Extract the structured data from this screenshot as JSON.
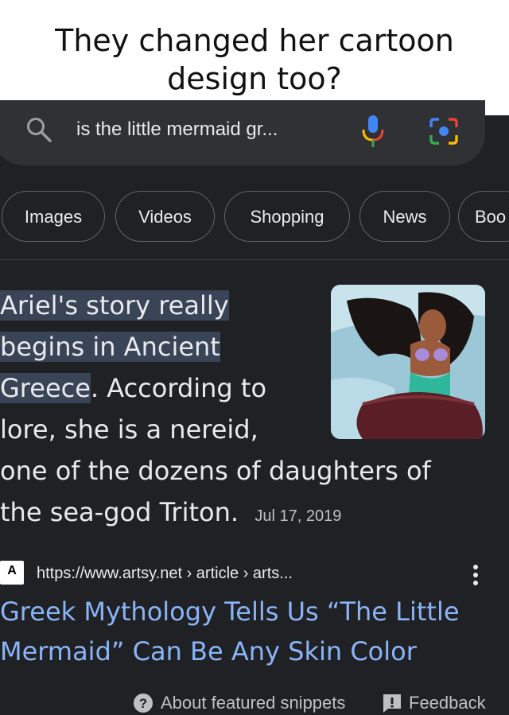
{
  "caption": {
    "line1": "They changed her cartoon",
    "line2": "design too?"
  },
  "search": {
    "query": "is the little mermaid gr...",
    "icons": [
      "search-icon",
      "mic-icon",
      "lens-icon"
    ],
    "colors": {
      "mic_blue": "#4285f4",
      "mic_red": "#ea4335",
      "mic_yellow": "#fbbc04",
      "mic_green": "#34a853",
      "bar_bg": "#303134"
    }
  },
  "chips": [
    "Images",
    "Videos",
    "Shopping",
    "News",
    "Boo"
  ],
  "snippet": {
    "line1": "Ariel's story really",
    "line2": "begins in Ancient",
    "line3_hl": "Greece",
    "line3_rest": ". According to",
    "line4": "lore, she is a nereid,",
    "line5": "one of the dozens of daughters of",
    "line6": "the sea-god Triton.",
    "date": "Jul 17, 2019",
    "highlight_color": "#394457"
  },
  "result": {
    "favicon_letter": "A",
    "url": "https://www.artsy.net › article › arts...",
    "title_line1": "Greek Mythology Tells Us “The Little",
    "title_line2": "Mermaid” Can Be Any Skin Color",
    "link_color": "#8ab4f8"
  },
  "footer": {
    "about": "About featured snippets",
    "feedback": "Feedback"
  }
}
